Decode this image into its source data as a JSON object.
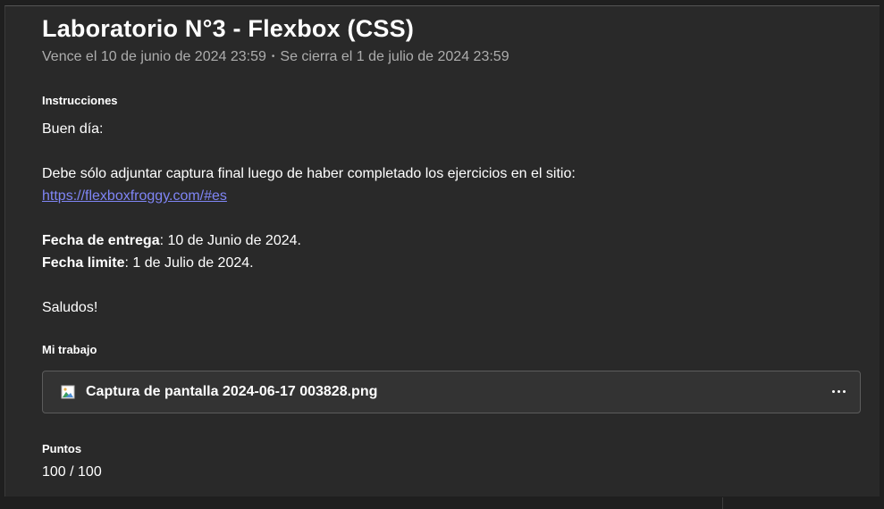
{
  "assignment": {
    "title": "Laboratorio N°3 - Flexbox (CSS)",
    "due": "Vence el 10 de junio de 2024 23:59",
    "separator": "•",
    "closes": "Se cierra el 1 de julio de 2024 23:59"
  },
  "instructions": {
    "label": "Instrucciones",
    "greeting": "Buen día:",
    "line1": "Debe sólo adjuntar captura final luego  de haber completado los ejercicios en el sitio:",
    "link": "https://flexboxfroggy.com/#es",
    "delivery_label": "Fecha de entrega",
    "delivery_value": ": 10 de Junio de 2024.",
    "limit_label": "Fecha limite",
    "limit_value": ": 1 de Julio de 2024.",
    "closing": "Saludos!"
  },
  "my_work": {
    "label": "Mi trabajo",
    "file_name": "Captura de pantalla 2024-06-17 003828.png",
    "file_icon": "image-file-icon",
    "more_icon": "more-options-icon"
  },
  "points": {
    "label": "Puntos",
    "value": "100 / 100"
  }
}
